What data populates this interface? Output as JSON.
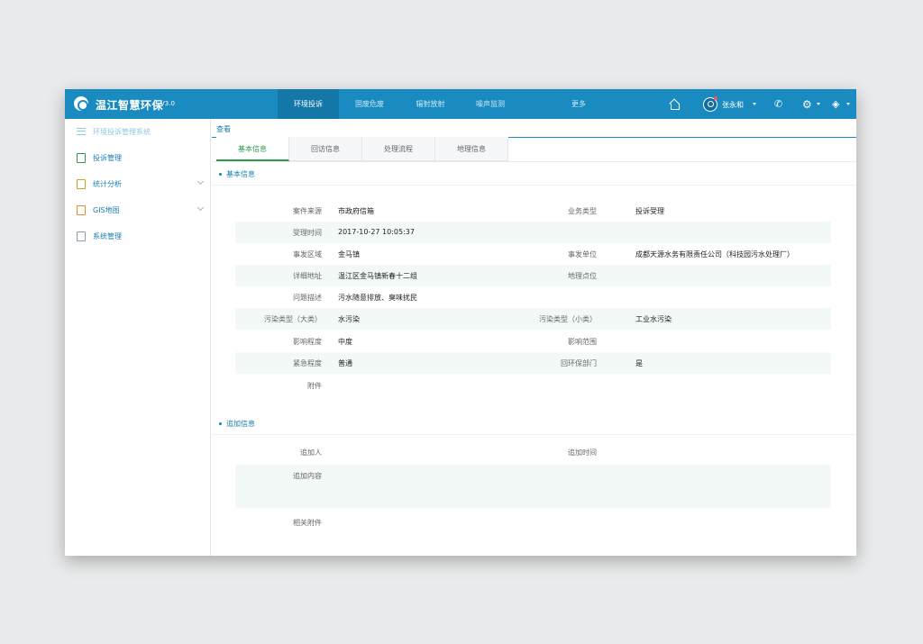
{
  "header": {
    "app_title": "温江智慧环保",
    "version": "V3.0",
    "nav": [
      "环境投诉",
      "固废危废",
      "辐射放射",
      "噪声监测",
      "更多"
    ],
    "active_nav": 0,
    "username": "张永和",
    "icons": [
      "home-icon",
      "user-icon",
      "phone-icon",
      "gear-icon",
      "layers-icon"
    ]
  },
  "sidebar": {
    "title": "环境投诉管理系统",
    "items": [
      {
        "label": "投诉管理",
        "icon": "cube-icon",
        "color": "#2f9a4a"
      },
      {
        "label": "统计分析",
        "icon": "chart-file-icon",
        "color": "#c9a227"
      },
      {
        "label": "GIS地图",
        "icon": "map-file-icon",
        "color": "#e8882a"
      },
      {
        "label": "系统管理",
        "icon": "doc-icon",
        "color": "#8a9aa6"
      }
    ]
  },
  "main": {
    "breadcrumb": "查看",
    "tabs": [
      "基本信息",
      "回访信息",
      "处理流程",
      "地理信息"
    ],
    "section_basic": "基本信息",
    "section_extra": "追加信息",
    "basic_rows": [
      {
        "label1": "案件来源",
        "value1": "市政府信箱",
        "label2": "业务类型",
        "value2": "投诉受理"
      },
      {
        "label1": "受理时间",
        "value1": "2017-10-27  10:05:37",
        "label2": "",
        "value2": ""
      },
      {
        "label1": "事发区域",
        "value1": "金马镇",
        "label2": "事发单位",
        "value2": "成都天源水务有限责任公司（科技园污水处理厂）"
      },
      {
        "label1": "详细地址",
        "value1": "温江区金马镇新春十二组",
        "label2": "地理点位",
        "value2": ""
      },
      {
        "label1": "问题描述",
        "value1": "污水随意排放、臭味扰民",
        "label2": "",
        "value2": ""
      },
      {
        "label1": "污染类型（大类）",
        "value1": "水污染",
        "label2": "污染类型（小类）",
        "value2": "工业水污染"
      },
      {
        "label1": "影响程度",
        "value1": "中度",
        "label2": "影响范围",
        "value2": ""
      },
      {
        "label1": "紧急程度",
        "value1": "普通",
        "label2": "回环保部门",
        "value2": "是"
      },
      {
        "label1": "附件",
        "value1": "",
        "label2": "",
        "value2": ""
      }
    ],
    "extra_rows": [
      {
        "label1": "追加人",
        "value1": "",
        "label2": "追加时间",
        "value2": ""
      },
      {
        "label1": "追加内容",
        "value1": "",
        "label2": "",
        "value2": ""
      },
      {
        "label1": "相关附件",
        "value1": "",
        "label2": "",
        "value2": ""
      }
    ]
  },
  "colors": {
    "primary": "#1a8bc0",
    "active_tab": "#2f9a4a",
    "row_alt": "#f3f9f7"
  }
}
